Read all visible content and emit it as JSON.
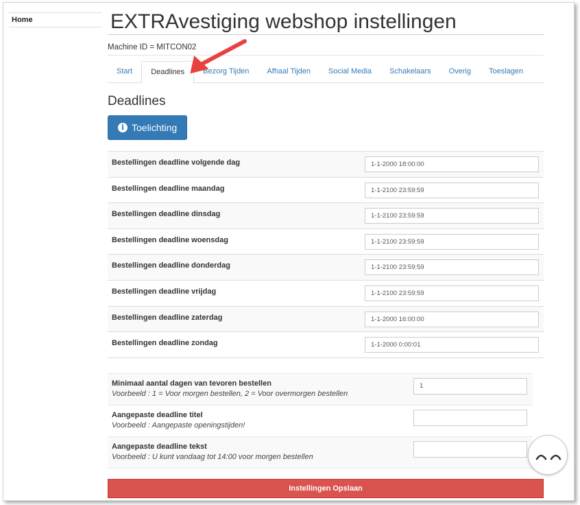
{
  "sidebar": {
    "home_label": "Home"
  },
  "header": {
    "title": "EXTRAvestiging webshop instellingen",
    "machine_id": "Machine ID = MITCON02"
  },
  "tabs": [
    {
      "label": "Start",
      "active": false
    },
    {
      "label": "Deadlines",
      "active": true
    },
    {
      "label": "Bezorg Tijden",
      "active": false
    },
    {
      "label": "Afhaal Tijden",
      "active": false
    },
    {
      "label": "Social Media",
      "active": false
    },
    {
      "label": "Schakelaars",
      "active": false
    },
    {
      "label": "Overig",
      "active": false
    },
    {
      "label": "Toeslagen",
      "active": false
    }
  ],
  "section": {
    "title": "Deadlines",
    "help_button_label": "Toelichting",
    "help_icon": "info-circle-icon"
  },
  "deadlines": [
    {
      "label": "Bestellingen deadline volgende dag",
      "value": "1-1-2000 18:00:00"
    },
    {
      "label": "Bestellingen deadline maandag",
      "value": "1-1-2100 23:59:59"
    },
    {
      "label": "Bestellingen deadline dinsdag",
      "value": "1-1-2100 23:59:59"
    },
    {
      "label": "Bestellingen deadline woensdag",
      "value": "1-1-2100 23:59:59"
    },
    {
      "label": "Bestellingen deadline donderdag",
      "value": "1-1-2100 23:59:59"
    },
    {
      "label": "Bestellingen deadline vrijdag",
      "value": "1-1-2100 23:59:59"
    },
    {
      "label": "Bestellingen deadline zaterdag",
      "value": "1-1-2000 16:00:00"
    },
    {
      "label": "Bestellingen deadline zondag",
      "value": "1-1-2000 0:00:01"
    }
  ],
  "extra_settings": [
    {
      "label": "Minimaal aantal dagen van tevoren bestellen",
      "example": "Voorbeeld : 1 = Voor morgen bestellen, 2 = Voor overmorgen bestellen",
      "value": "1"
    },
    {
      "label": "Aangepaste deadline titel",
      "example": "Voorbeeld : Aangepaste openingstijden!",
      "value": ""
    },
    {
      "label": "Aangepaste deadline tekst",
      "example": "Voorbeeld : U kunt vandaag tot 14:00 voor morgen bestellen",
      "value": ""
    }
  ],
  "save_button_label": "Instellingen Opslaan",
  "colors": {
    "primary": "#337ab7",
    "danger": "#d9534f",
    "annotation_arrow": "#e8413e"
  }
}
